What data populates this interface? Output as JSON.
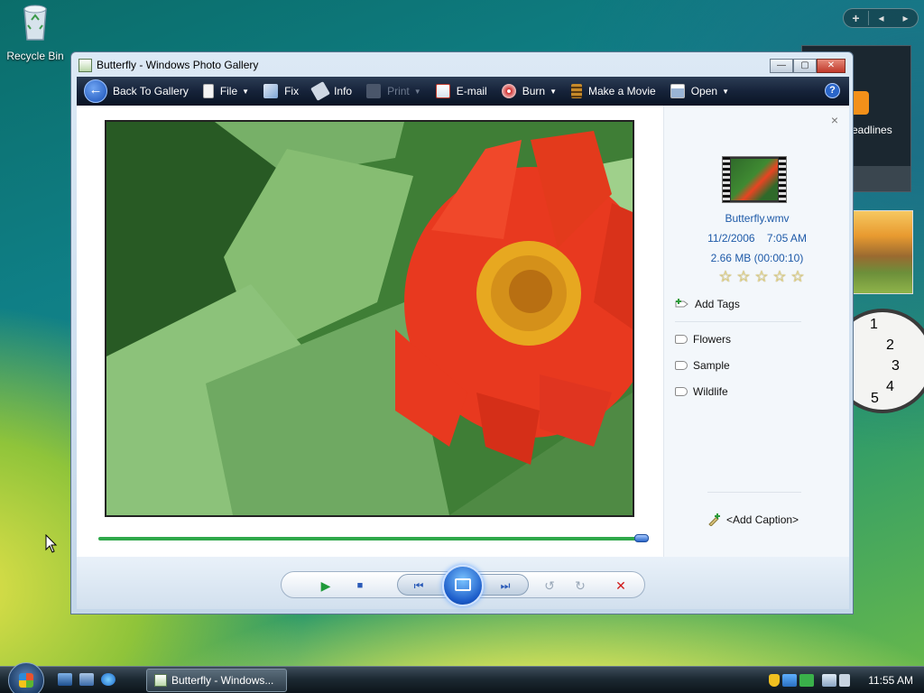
{
  "desktop": {
    "recycle_bin_label": "Recycle Bin",
    "feed_gadget_text": "eadlines"
  },
  "window": {
    "title": "Butterfly - Windows Photo Gallery"
  },
  "toolbar": {
    "back_label": "Back To Gallery",
    "file_label": "File",
    "fix_label": "Fix",
    "info_label": "Info",
    "print_label": "Print",
    "email_label": "E-mail",
    "burn_label": "Burn",
    "movie_label": "Make a Movie",
    "open_label": "Open",
    "help_label": "?"
  },
  "info_pane": {
    "close_label": "×",
    "filename": "Butterfly.wmv",
    "date": "11/2/2006",
    "time": "7:05 AM",
    "size": "2.66 MB (00:00:10)",
    "rating": 0,
    "rating_max": 5,
    "add_tags_label": "Add Tags",
    "tags": [
      "Flowers",
      "Sample",
      "Wildlife"
    ],
    "add_caption_label": "<Add Caption>"
  },
  "playback": {
    "progress": 1.0
  },
  "taskbar": {
    "task_label": "Butterfly - Windows...",
    "clock": "11:55 AM"
  },
  "colors": {
    "toolbar_bg": "#16233a",
    "link_blue": "#1e5aa8",
    "seek_green": "#2fa84a",
    "delete_red": "#d01818"
  }
}
